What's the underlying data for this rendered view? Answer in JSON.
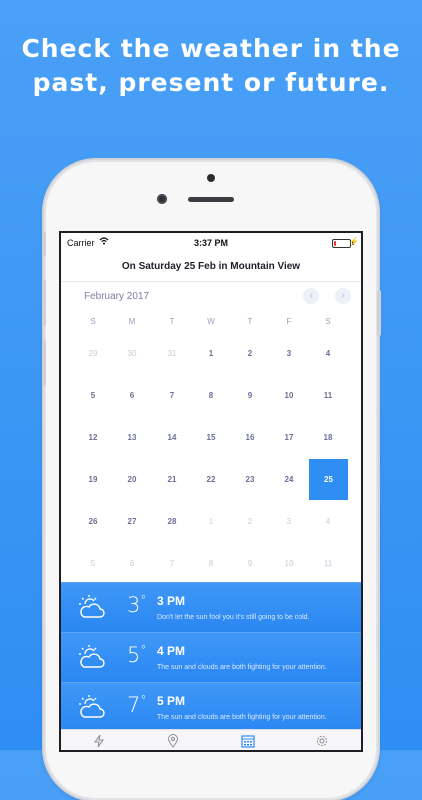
{
  "promo": {
    "line1": "Check the weather in the",
    "line2": "past, present or future."
  },
  "status_bar": {
    "carrier": "Carrier",
    "time": "3:37 PM",
    "battery_percent": 15
  },
  "nav": {
    "title": "On Saturday 25 Feb in Mountain View"
  },
  "calendar": {
    "month": "February 2017",
    "prev_icon": "chevron-left-icon",
    "next_icon": "chevron-right-icon",
    "weekdays": [
      "S",
      "M",
      "T",
      "W",
      "T",
      "F",
      "S"
    ],
    "weeks": [
      [
        "29",
        "30",
        "31",
        "1",
        "2",
        "3",
        "4"
      ],
      [
        "5",
        "6",
        "7",
        "8",
        "9",
        "10",
        "11"
      ],
      [
        "12",
        "13",
        "14",
        "15",
        "16",
        "17",
        "18"
      ],
      [
        "19",
        "20",
        "21",
        "22",
        "23",
        "24",
        "25"
      ],
      [
        "26",
        "27",
        "28",
        "1",
        "2",
        "3",
        "4"
      ],
      [
        "5",
        "6",
        "7",
        "8",
        "9",
        "10",
        "11"
      ]
    ],
    "selected": "25",
    "accent_color": "#2f8ef3"
  },
  "forecast": [
    {
      "icon": "partly-sunny-icon",
      "temp": "3",
      "degree": "°",
      "time": "3 PM",
      "desc": "Don't let the sun fool you it's still going to be cold."
    },
    {
      "icon": "partly-sunny-icon",
      "temp": "5",
      "degree": "°",
      "time": "4 PM",
      "desc": "The sun and clouds are both fighting for your attention."
    },
    {
      "icon": "partly-sunny-icon",
      "temp": "7",
      "degree": "°",
      "time": "5 PM",
      "desc": "The sun and clouds are both fighting for your attention."
    }
  ],
  "tabbar": {
    "tabs": [
      {
        "icon": "lightning-icon"
      },
      {
        "icon": "location-pin-icon"
      },
      {
        "icon": "calendar-icon",
        "active": true
      },
      {
        "icon": "gear-icon"
      }
    ]
  }
}
